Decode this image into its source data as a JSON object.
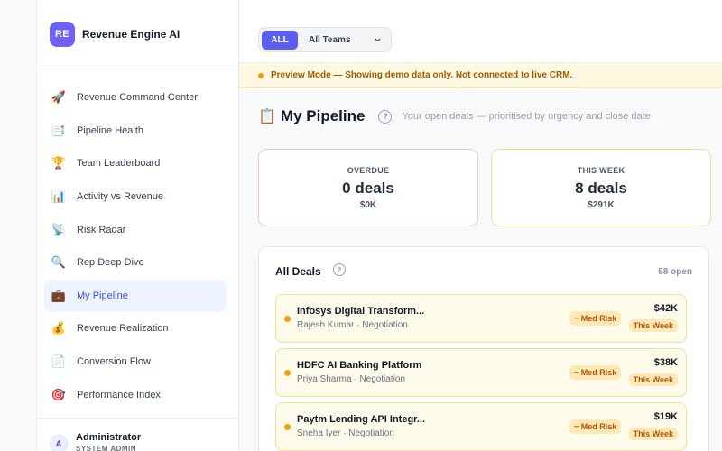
{
  "brand": {
    "logo_initials": "RE",
    "name": "Revenue Engine AI"
  },
  "sidebar": {
    "items": [
      {
        "label": "Revenue Command Center",
        "icon": "🚀"
      },
      {
        "label": "Pipeline Health",
        "icon": "📑"
      },
      {
        "label": "Team Leaderboard",
        "icon": "🏆"
      },
      {
        "label": "Activity vs Revenue",
        "icon": "📊"
      },
      {
        "label": "Risk Radar",
        "icon": "📡"
      },
      {
        "label": "Rep Deep Dive",
        "icon": "🔍"
      },
      {
        "label": "My Pipeline",
        "icon": "💼",
        "active": true
      },
      {
        "label": "Revenue Realization",
        "icon": "💰"
      },
      {
        "label": "Conversion Flow",
        "icon": "📄"
      },
      {
        "label": "Performance Index",
        "icon": "🎯"
      }
    ]
  },
  "user": {
    "initial": "A",
    "name": "Administrator",
    "role": "SYSTEM ADMIN"
  },
  "filter": {
    "all_label": "ALL",
    "team_value": "All Teams",
    "chevron": "⌄"
  },
  "banner": {
    "text": "Preview Mode — Showing demo data only. Not connected to live CRM."
  },
  "page": {
    "icon": "📋",
    "title": "My Pipeline",
    "help_icon": "?",
    "subtitle": "Your open deals — prioritised by urgency and close date"
  },
  "stats": {
    "overdue": {
      "label": "OVERDUE",
      "value": "0 deals",
      "amount": "$0K"
    },
    "this_week": {
      "label": "THIS WEEK",
      "value": "8 deals",
      "amount": "$291K"
    }
  },
  "deals": {
    "title": "All Deals",
    "help_icon": "?",
    "count": "58 open",
    "items": [
      {
        "name": "Infosys Digital Transform...",
        "meta": "Rajesh Kumar · Negotiation",
        "risk": "~ Med Risk",
        "amount": "$42K",
        "when": "This Week"
      },
      {
        "name": "HDFC AI Banking Platform",
        "meta": "Priya Sharma · Negotiation",
        "risk": "~ Med Risk",
        "amount": "$38K",
        "when": "This Week"
      },
      {
        "name": "Paytm Lending API Integr...",
        "meta": "Sneha Iyer · Negotiation",
        "risk": "~ Med Risk",
        "amount": "$19K",
        "when": "This Week"
      }
    ]
  },
  "colors": {
    "accent": "#5b5ef0",
    "warning": "#f59e0b",
    "risk_text": "#b45309"
  }
}
